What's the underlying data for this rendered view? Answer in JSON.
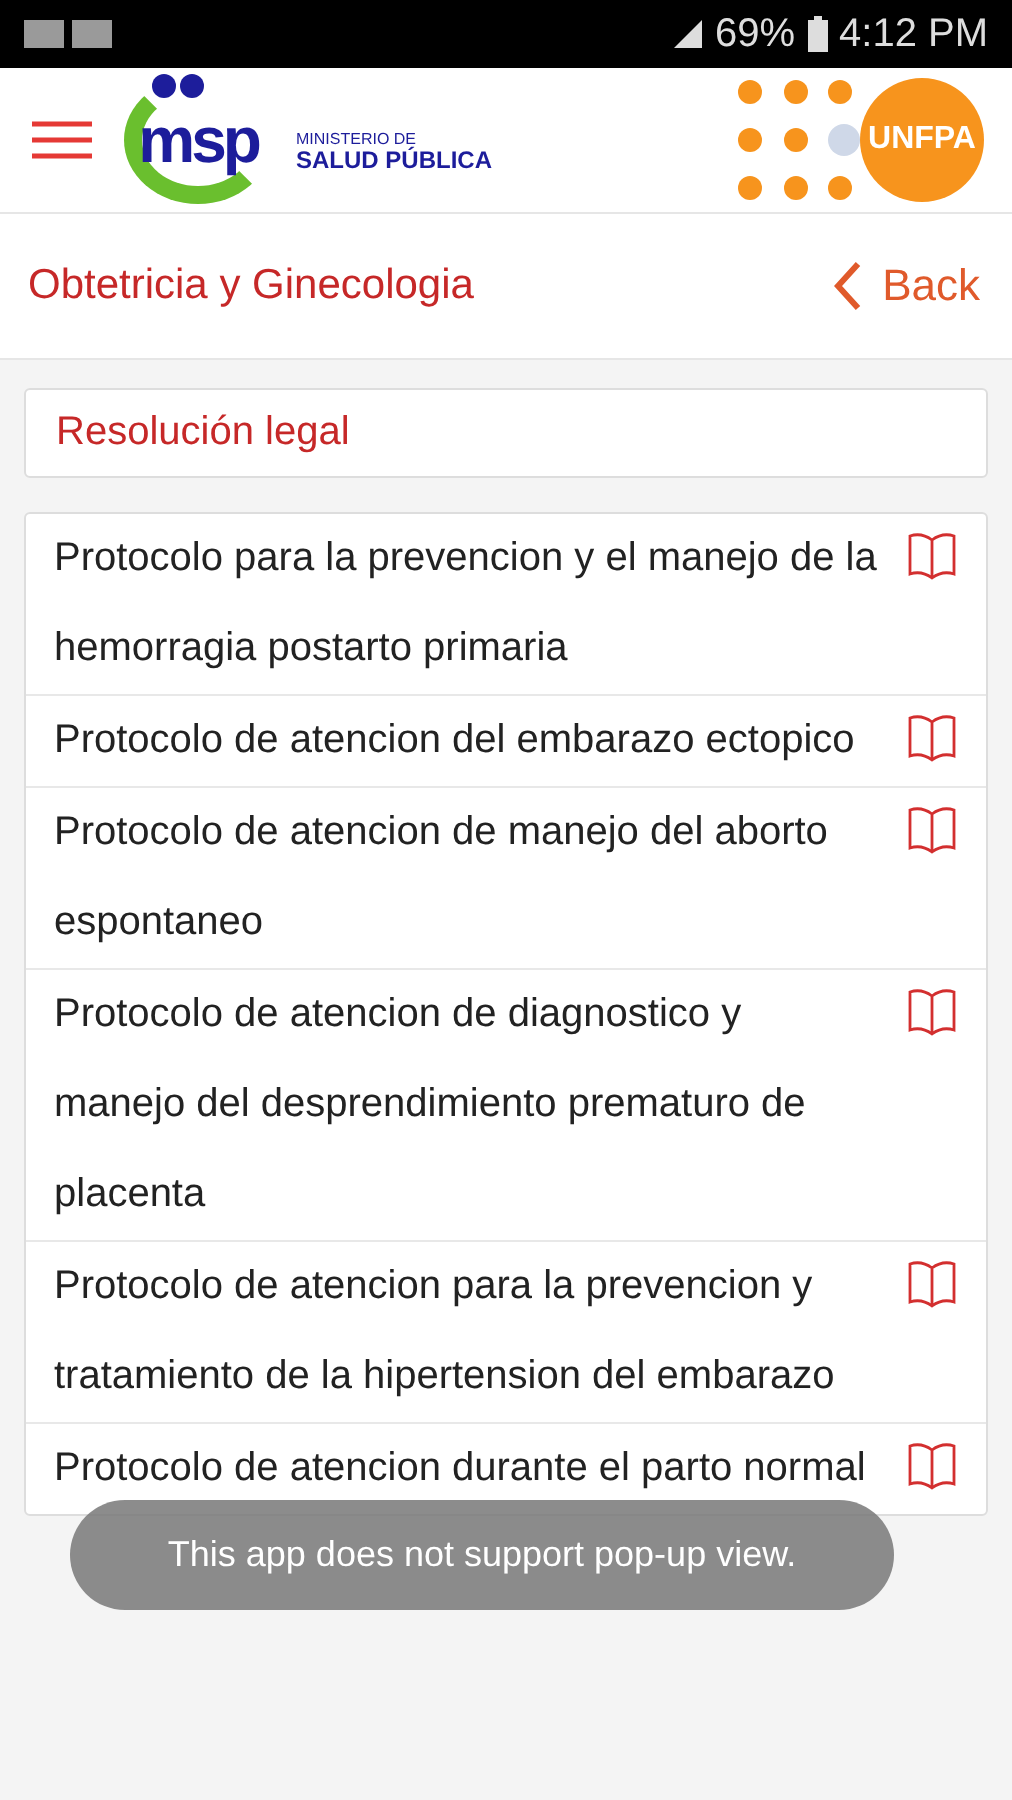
{
  "status_bar": {
    "battery": "69%",
    "time": "4:12 PM"
  },
  "header": {
    "logo_left": {
      "mark": "msp",
      "line_1": "MINISTERIO DE",
      "line_2": "SALUD PÚBLICA"
    },
    "logo_right": "UNFPA"
  },
  "title_bar": {
    "title": "Obtetricia y Ginecologia",
    "back": "Back"
  },
  "section": {
    "title": "Resolución legal"
  },
  "items": [
    {
      "text": "Protocolo para la prevencion y el manejo de la hemorragia postarto primaria"
    },
    {
      "text": "Protocolo de atencion del embarazo ectopico"
    },
    {
      "text": "Protocolo de atencion de manejo del aborto espontaneo"
    },
    {
      "text": "Protocolo de atencion de diagnostico y manejo del desprendimiento prematuro de placenta"
    },
    {
      "text": "Protocolo de atencion para la prevencion y tratamiento de la hipertension del embarazo"
    },
    {
      "text": "Protocolo de atencion durante el parto normal"
    }
  ],
  "toast": "This app does not support pop-up view."
}
